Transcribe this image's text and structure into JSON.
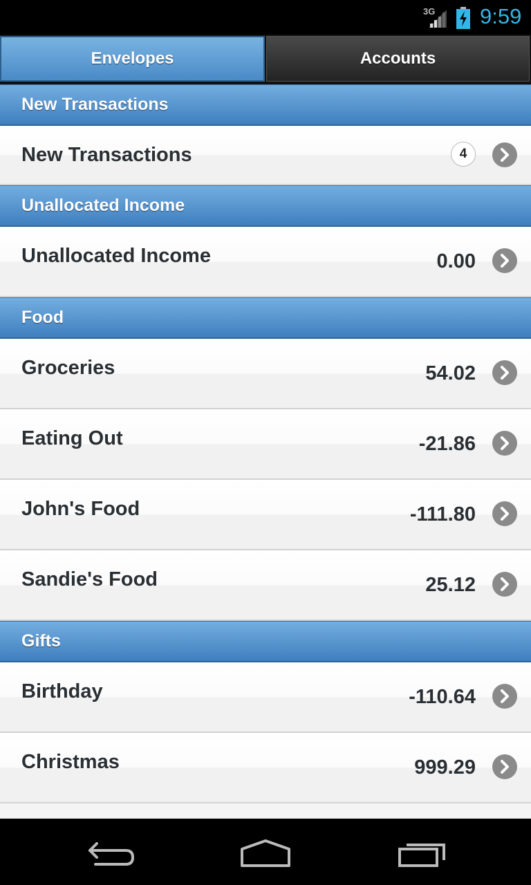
{
  "status_bar": {
    "network": "3G",
    "time": "9:59"
  },
  "tabs": [
    {
      "label": "Envelopes",
      "active": true
    },
    {
      "label": "Accounts",
      "active": false
    }
  ],
  "sections": {
    "new_transactions": {
      "title": "New Transactions",
      "row": {
        "label": "New Transactions",
        "badge": "4"
      }
    },
    "unallocated": {
      "title": "Unallocated Income",
      "row": {
        "label": "Unallocated Income",
        "value": "0.00"
      }
    },
    "food": {
      "title": "Food",
      "rows": [
        {
          "label": "Groceries",
          "value": "54.02"
        },
        {
          "label": "Eating Out",
          "value": "-21.86"
        },
        {
          "label": "John's Food",
          "value": "-111.80"
        },
        {
          "label": "Sandie's Food",
          "value": "25.12"
        }
      ]
    },
    "gifts": {
      "title": "Gifts",
      "rows": [
        {
          "label": "Birthday",
          "value": "-110.64"
        },
        {
          "label": "Christmas",
          "value": "999.29"
        }
      ]
    }
  },
  "icons": {
    "row_action": "chevron-right-circle-icon",
    "nav_back": "back-icon",
    "nav_home": "home-icon",
    "nav_recents": "recent-apps-icon"
  },
  "colors": {
    "accent": "#33b5e5",
    "section_header": "#4a8ac6",
    "text": "#2a2f33"
  }
}
